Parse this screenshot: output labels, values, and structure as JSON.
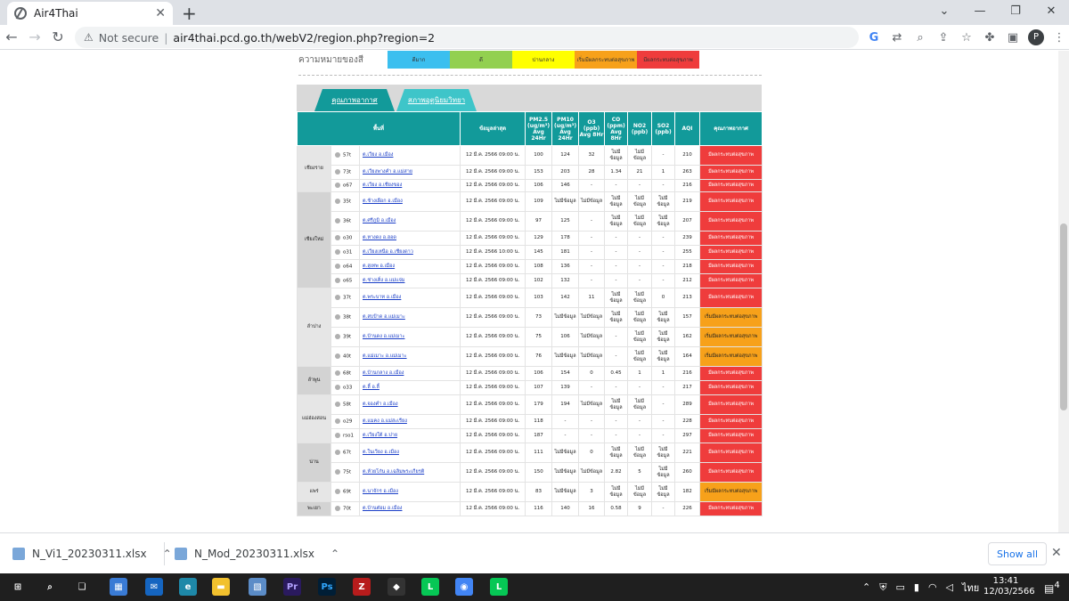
{
  "browser": {
    "tab_title": "Air4Thai",
    "not_secure": "Not secure",
    "url": "air4thai.pcd.go.th/webV2/region.php?region=2",
    "avatar_letter": "P"
  },
  "legend": {
    "label": "ความหมายของสี",
    "items": [
      {
        "text": "ดีมาก",
        "color": "#3bbfef"
      },
      {
        "text": "ดี",
        "color": "#92d050"
      },
      {
        "text": "ปานกลาง",
        "color": "#ffff00"
      },
      {
        "text": "เริ่มมีผลกระทบต่อสุขภาพ",
        "color": "#f7a11a"
      },
      {
        "text": "มีผลกระทบต่อสุขภาพ",
        "color": "#ef3c3c"
      }
    ]
  },
  "tabs": {
    "active": "คุณภาพอากาศ",
    "inactive": "สภาพอุตุนิยมวิทยา"
  },
  "table": {
    "headers": {
      "area": "พื้นที่",
      "latest": "ข้อมูลล่าสุด",
      "pm25": "PM2.5 (ug/m³) Avg 24Hr",
      "pm10": "PM10 (ug/m³) Avg 24Hr",
      "o3": "O3 (ppb) Avg 8Hr",
      "co": "CO (ppm) Avg 8Hr",
      "no2": "NO2 (ppb)",
      "so2": "SO2 (ppb)",
      "aqi": "AQI",
      "quality": "คุณภาพอากาศ"
    },
    "rows": [
      {
        "prov": "เชียงราย",
        "span": 3,
        "station": "57t",
        "area": "ต.เวียง อ.เมือง",
        "time": "12 มี.ค. 2566 09:00 น.",
        "pm25": "100",
        "pm10": "124",
        "o3": "32",
        "co": "ไม่มีข้อมูล",
        "no2": "ไม่มีข้อมูล",
        "so2": "-",
        "aqi": "210",
        "q": "มีผลกระทบต่อสุขภาพ",
        "level": "red",
        "h": 22
      },
      {
        "station": "73t",
        "area": "ต.เวียงพางคำ อ.แม่สาย",
        "time": "12 มี.ค. 2566 09:00 น.",
        "pm25": "153",
        "pm10": "203",
        "o3": "28",
        "co": "1.34",
        "no2": "21",
        "so2": "1",
        "aqi": "263",
        "q": "มีผลกระทบต่อสุขภาพ",
        "level": "red",
        "h": 16
      },
      {
        "station": "o67",
        "area": "ต.เวียง อ.เชียงของ",
        "time": "12 มี.ค. 2566 09:00 น.",
        "pm25": "106",
        "pm10": "146",
        "o3": "-",
        "co": "-",
        "no2": "-",
        "so2": "-",
        "aqi": "216",
        "q": "มีผลกระทบต่อสุขภาพ",
        "level": "red",
        "h": 14
      },
      {
        "prov": "เชียงใหม่",
        "span": 6,
        "alt": true,
        "station": "35t",
        "area": "ต.ช้างเผือก อ.เมือง",
        "time": "12 มี.ค. 2566 09:00 น.",
        "pm25": "109",
        "pm10": "ไม่มีข้อมูล",
        "o3": "ไม่มีข้อมูล",
        "co": "ไม่มีข้อมูล",
        "no2": "ไม่มีข้อมูล",
        "so2": "ไม่มีข้อมูล",
        "aqi": "219",
        "q": "มีผลกระทบต่อสุขภาพ",
        "level": "red",
        "h": 22
      },
      {
        "station": "36t",
        "area": "ต.ศรีภูมิ อ.เมือง",
        "time": "12 มี.ค. 2566 09:00 น.",
        "pm25": "97",
        "pm10": "125",
        "o3": "-",
        "co": "ไม่มีข้อมูล",
        "no2": "ไม่มีข้อมูล",
        "so2": "ไม่มีข้อมูล",
        "aqi": "207",
        "q": "มีผลกระทบต่อสุขภาพ",
        "level": "red",
        "h": 22
      },
      {
        "station": "o30",
        "area": "ต.หางดง อ.ฮอด",
        "time": "12 มี.ค. 2566 09:00 น.",
        "pm25": "129",
        "pm10": "178",
        "o3": "-",
        "co": "-",
        "no2": "-",
        "so2": "-",
        "aqi": "239",
        "q": "มีผลกระทบต่อสุขภาพ",
        "level": "red",
        "h": 16
      },
      {
        "station": "o31",
        "area": "ต.เวียงเหนือ อ.เชียงดาว",
        "time": "12 มี.ค. 2566 10:00 น.",
        "pm25": "145",
        "pm10": "181",
        "o3": "-",
        "co": "-",
        "no2": "-",
        "so2": "-",
        "aqi": "255",
        "q": "มีผลกระทบต่อสุขภาพ",
        "level": "red",
        "h": 16
      },
      {
        "station": "o64",
        "area": "ต.สุเทพ อ.เมือง",
        "time": "12 มี.ค. 2566 09:00 น.",
        "pm25": "108",
        "pm10": "136",
        "o3": "-",
        "co": "-",
        "no2": "-",
        "so2": "-",
        "aqi": "218",
        "q": "มีผลกระทบต่อสุขภาพ",
        "level": "red",
        "h": 16
      },
      {
        "station": "o65",
        "area": "ต.ช่างเคิ่ง อ.แม่แจ่ม",
        "time": "12 มี.ค. 2566 09:00 น.",
        "pm25": "102",
        "pm10": "132",
        "o3": "-",
        "co": "-",
        "no2": "-",
        "so2": "-",
        "aqi": "212",
        "q": "มีผลกระทบต่อสุขภาพ",
        "level": "red",
        "h": 16
      },
      {
        "prov": "ลำปาง",
        "span": 4,
        "station": "37t",
        "area": "ต.พระบาท อ.เมือง",
        "time": "12 มี.ค. 2566 09:00 น.",
        "pm25": "103",
        "pm10": "142",
        "o3": "11",
        "co": "ไม่มีข้อมูล",
        "no2": "ไม่มีข้อมูล",
        "so2": "0",
        "aqi": "213",
        "q": "มีผลกระทบต่อสุขภาพ",
        "level": "red",
        "h": 22
      },
      {
        "station": "38t",
        "area": "ต.สบป้าด อ.แม่เมาะ",
        "time": "12 มี.ค. 2566 09:00 น.",
        "pm25": "73",
        "pm10": "ไม่มีข้อมูล",
        "o3": "ไม่มีข้อมูล",
        "co": "ไม่มีข้อมูล",
        "no2": "ไม่มีข้อมูล",
        "so2": "ไม่มีข้อมูล",
        "aqi": "157",
        "q": "เริ่มมีผลกระทบต่อสุขภาพ",
        "level": "orange",
        "h": 22
      },
      {
        "station": "39t",
        "area": "ต.บ้านดง อ.แม่เมาะ",
        "time": "12 มี.ค. 2566 09:00 น.",
        "pm25": "75",
        "pm10": "106",
        "o3": "ไม่มีข้อมูล",
        "co": "-",
        "no2": "ไม่มีข้อมูล",
        "so2": "ไม่มีข้อมูล",
        "aqi": "162",
        "q": "เริ่มมีผลกระทบต่อสุขภาพ",
        "level": "orange",
        "h": 22
      },
      {
        "station": "40t",
        "area": "ต.แม่เมาะ อ.แม่เมาะ",
        "time": "12 มี.ค. 2566 09:00 น.",
        "pm25": "76",
        "pm10": "ไม่มีข้อมูล",
        "o3": "ไม่มีข้อมูล",
        "co": "-",
        "no2": "ไม่มีข้อมูล",
        "so2": "ไม่มีข้อมูล",
        "aqi": "164",
        "q": "เริ่มมีผลกระทบต่อสุขภาพ",
        "level": "orange",
        "h": 22
      },
      {
        "prov": "ลำพูน",
        "span": 2,
        "alt": true,
        "station": "68t",
        "area": "ต.บ้านกลาง อ.เมือง",
        "time": "12 มี.ค. 2566 09:00 น.",
        "pm25": "106",
        "pm10": "154",
        "o3": "0",
        "co": "0.45",
        "no2": "1",
        "so2": "1",
        "aqi": "216",
        "q": "มีผลกระทบต่อสุขภาพ",
        "level": "red",
        "h": 16
      },
      {
        "station": "o33",
        "area": "ต.ลี้ อ.ลี้",
        "time": "12 มี.ค. 2566 09:00 น.",
        "pm25": "107",
        "pm10": "139",
        "o3": "-",
        "co": "-",
        "no2": "-",
        "so2": "-",
        "aqi": "217",
        "q": "มีผลกระทบต่อสุขภาพ",
        "level": "red",
        "h": 16
      },
      {
        "prov": "แม่ฮ่องสอน",
        "span": 3,
        "station": "58t",
        "area": "ต.จองคำ อ.เมือง",
        "time": "12 มี.ค. 2566 09:00 น.",
        "pm25": "179",
        "pm10": "194",
        "o3": "ไม่มีข้อมูล",
        "co": "ไม่มีข้อมูล",
        "no2": "ไม่มีข้อมูล",
        "so2": "-",
        "aqi": "289",
        "q": "มีผลกระทบต่อสุขภาพ",
        "level": "red",
        "h": 22
      },
      {
        "station": "o29",
        "area": "ต.แมคง อ.แม่สะเรียง",
        "time": "12 มี.ค. 2566 09:00 น.",
        "pm25": "118",
        "pm10": "-",
        "o3": "-",
        "co": "-",
        "no2": "-",
        "so2": "-",
        "aqi": "228",
        "q": "มีผลกระทบต่อสุขภาพ",
        "level": "red",
        "h": 16
      },
      {
        "station": "rso1",
        "area": "ต.เวียงใต้ อ.ปาย",
        "time": "12 มี.ค. 2566 09:00 น.",
        "pm25": "187",
        "pm10": "-",
        "o3": "-",
        "co": "-",
        "no2": "-",
        "so2": "-",
        "aqi": "297",
        "q": "มีผลกระทบต่อสุขภาพ",
        "level": "red",
        "h": 16
      },
      {
        "prov": "น่าน",
        "span": 2,
        "alt": true,
        "station": "67t",
        "area": "ต.ในเวียง อ.เมือง",
        "time": "12 มี.ค. 2566 09:00 น.",
        "pm25": "111",
        "pm10": "ไม่มีข้อมูล",
        "o3": "0",
        "co": "ไม่มีข้อมูล",
        "no2": "ไม่มีข้อมูล",
        "so2": "ไม่มีข้อมูล",
        "aqi": "221",
        "q": "มีผลกระทบต่อสุขภาพ",
        "level": "red",
        "h": 22
      },
      {
        "station": "75t",
        "area": "ต.ห้วยโก๋น อ.เฉลิมพระเกียรติ",
        "time": "12 มี.ค. 2566 09:00 น.",
        "pm25": "150",
        "pm10": "ไม่มีข้อมูล",
        "o3": "ไม่มีข้อมูล",
        "co": "2.82",
        "no2": "5",
        "so2": "ไม่มีข้อมูล",
        "aqi": "260",
        "q": "มีผลกระทบต่อสุขภาพ",
        "level": "red",
        "h": 22
      },
      {
        "prov": "แพร่",
        "span": 1,
        "station": "69t",
        "area": "ต.นาจักร อ.เมือง",
        "time": "12 มี.ค. 2566 09:00 น.",
        "pm25": "83",
        "pm10": "ไม่มีข้อมูล",
        "o3": "3",
        "co": "ไม่มีข้อมูล",
        "no2": "ไม่มีข้อมูล",
        "so2": "ไม่มีข้อมูล",
        "aqi": "182",
        "q": "เริ่มมีผลกระทบต่อสุขภาพ",
        "level": "orange",
        "h": 22
      },
      {
        "prov": "พะเยา",
        "span": 1,
        "alt": true,
        "station": "70t",
        "area": "ต.บ้านต๋อม อ.เมือง",
        "time": "12 มี.ค. 2566 09:00 น.",
        "pm25": "116",
        "pm10": "140",
        "o3": "16",
        "co": "0.58",
        "no2": "9",
        "so2": "-",
        "aqi": "226",
        "q": "มีผลกระทบต่อสุขภาพ",
        "level": "red",
        "h": 16
      }
    ]
  },
  "downloads": {
    "file1": "N_Vi1_20230311.xlsx",
    "file2": "N_Mod_20230311.xlsx",
    "show_all": "Show all"
  },
  "taskbar": {
    "lang": "ไทย",
    "time": "13:41",
    "date": "12/03/2566",
    "notifications": "4"
  }
}
